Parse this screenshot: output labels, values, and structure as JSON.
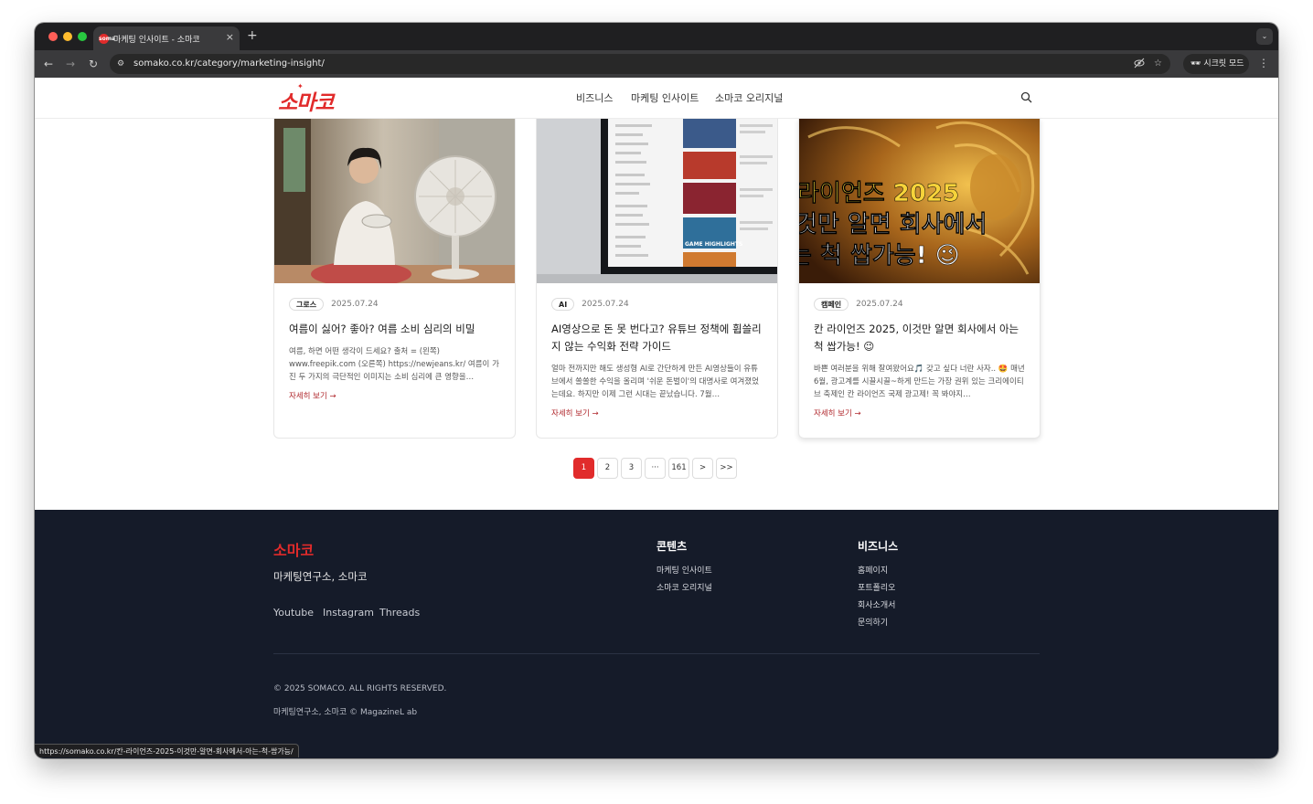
{
  "browser": {
    "tab_title": "마케팅 인사이트 - 소마코",
    "tab_favicon": "soma",
    "new_tab": "+",
    "close": "×",
    "url": "somako.co.kr/category/marketing-insight/",
    "incognito_label": "시크릿 모드",
    "status_url": "https://somako.co.kr/칸-라이언즈-2025-이것만-알면-회사에서-아는-척-쌉가능/",
    "icons": [
      "back-icon",
      "forward-icon",
      "reload-icon",
      "site-info-icon",
      "eye-off-icon",
      "star-icon",
      "incognito-icon",
      "kebab-menu-icon",
      "tab-search-icon"
    ]
  },
  "site": {
    "logo": "소마코",
    "nav": [
      "비즈니스",
      "마케팅 인사이트",
      "소마코 오리지널"
    ],
    "search_icon": "search-icon"
  },
  "posts": [
    {
      "category": "그로스",
      "date": "2025.07.24",
      "title": "여름이 싫어? 좋아? 여름 소비 심리의 비밀",
      "excerpt": "여름, 하면 어떤 생각이 드세요? 출처 = (왼쪽) www.freepik.com (오른쪽) https://newjeans.kr/ 여름이 가진 두 가지의 극단적인 이미지는 소비 심리에 큰 영향을…",
      "more": "자세히 보기 →"
    },
    {
      "category": "AI",
      "date": "2025.07.24",
      "title": "AI영상으로 돈 못 번다고? 유튜브 정책에 휩쓸리지 않는 수익화 전략 가이드",
      "excerpt": "얼마 전까지만 해도 생성형 AI로 간단하게 만든 AI영상들이 유튜브에서 쏠쏠한 수익을 올리며 '쉬운 돈벌이'의 대명사로 여겨졌었는데요. 하지만 이제 그런 시대는 끝났습니다. 7월…",
      "more": "자세히 보기 →",
      "thumb_labels": [
        "GAME HIGHLIGHTS"
      ]
    },
    {
      "category": "캠페인",
      "date": "2025.07.24",
      "title": "칸 라이언즈 2025, 이것만 알면 회사에서 아는 척 쌉가능! 😉",
      "excerpt": "바쁜 여러분을 위해 잘여왔어요🎵 갖고 싶다 너란 사자.. 🤩 매년 6월, 광고계를 시끌시끌~하게 만드는 가장 권위 있는 크리에이티브 축제인 칸 라이언즈 국제 광고제! 꼭 봐야지…",
      "more": "자세히 보기 →",
      "thumb_lines": [
        "라이언즈 2025",
        "것만 알면 회사에서",
        "는 척 쌉가능! 😉"
      ]
    }
  ],
  "pagination": [
    "1",
    "2",
    "3",
    "···",
    "161",
    ">",
    ">>"
  ],
  "pagination_active": "1",
  "footer": {
    "brand": "소마코",
    "tagline": "마케팅연구소, 소마코",
    "social": [
      "Youtube",
      "Instagram",
      "Threads"
    ],
    "content_title": "콘텐츠",
    "content_links": [
      "마케팅 인사이트",
      "소마코 오리지널"
    ],
    "business_title": "비즈니스",
    "business_links": [
      "홈페이지",
      "포트폴리오",
      "회사소개서",
      "문의하기"
    ],
    "copyright": "© 2025 SOMACO. ALL RIGHTS RESERVED.",
    "credit": "마케팅연구소, 소마코 © MagazineL ab"
  },
  "colors": {
    "brand_red": "#e12b2b",
    "footer_bg": "#151b29",
    "link_red": "#b0282d"
  }
}
